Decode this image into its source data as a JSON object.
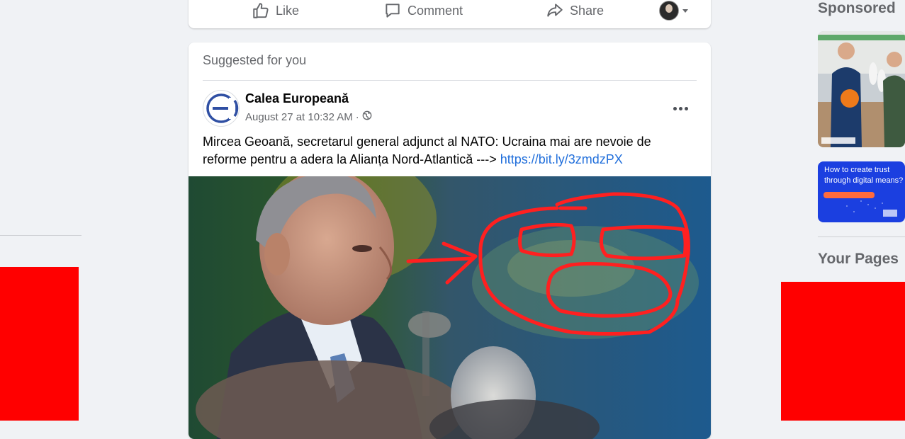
{
  "action_bar": {
    "like_label": "Like",
    "comment_label": "Comment",
    "share_label": "Share"
  },
  "post": {
    "suggested_label": "Suggested for you",
    "page_name": "Calea Europeană",
    "timestamp": "August 27 at 10:32 AM",
    "separator": "·",
    "audience_icon": "globe-icon",
    "text": "Mircea Geoană, secretarul general adjunct al NATO: Ucraina mai are nevoie de reforme pentru a adera la Alianța Nord-Atlantică --->",
    "link": "https://bit.ly/3zmdzPX"
  },
  "sidebar": {
    "sponsored_heading": "Sponsored",
    "ad2_text": "How to create trust through digital means?",
    "your_pages_heading": "Your Pages"
  },
  "colors": {
    "accent_link": "#216fdb",
    "annotation_red": "#ff0000",
    "background": "#f0f2f5"
  }
}
